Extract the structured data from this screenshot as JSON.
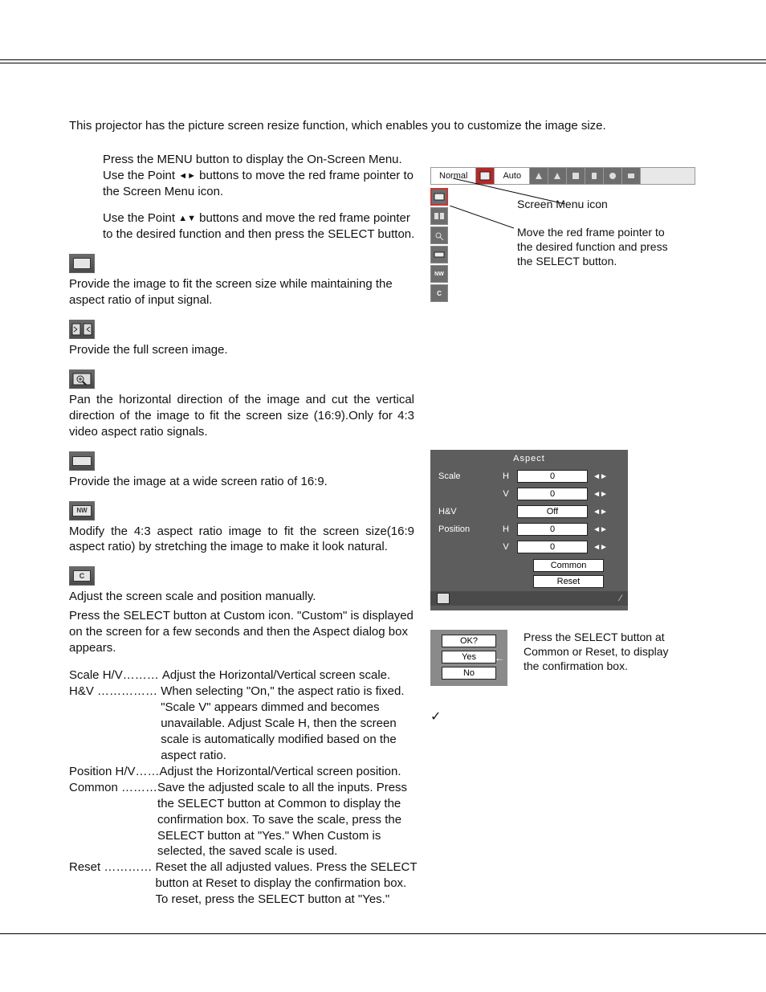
{
  "intro": "This projector has the picture screen resize function, which enables you to customize the image size.",
  "steps": {
    "s1a": "Press the MENU button to display the On-Screen Menu. Use the Point ",
    "s1b": " buttons to move the red frame pointer to the Screen Menu icon.",
    "s2a": "Use the Point ",
    "s2b": " buttons and move the red frame pointer to the desired function and then press the SELECT button."
  },
  "sections": {
    "normal": "Provide the image to fit the screen size while maintaining the aspect ratio of input signal.",
    "full": "Provide the full screen image.",
    "zoom": "Pan the horizontal direction of the image and cut the vertical direction of the image to fit the screen size (16:9).Only for 4:3 video aspect ratio signals.",
    "wide": "Provide the image at a wide screen ratio of 16:9.",
    "nw": "Modify the 4:3 aspect ratio image to fit the screen size(16:9 aspect ratio) by stretching the image to make it look natural.",
    "custom1": "Adjust the screen scale and position manually.",
    "custom2": "Press the SELECT button at Custom icon. \"Custom\" is displayed on the screen for a few seconds and then the Aspect dialog box appears."
  },
  "defs": {
    "scale": {
      "term": "Scale H/V",
      "dots": "………",
      "body": "Adjust the Horizontal/Vertical screen scale."
    },
    "hv": {
      "term": "H&V",
      "dots": " ……………",
      "body": "When selecting \"On,\" the aspect ratio is fixed. \"Scale V\" appears dimmed and becomes unavailable. Adjust Scale H, then the screen scale is automatically modified based on the aspect ratio."
    },
    "pos": {
      "term": "Position H/V",
      "dots": "……",
      "body": "Adjust the Horizontal/Vertical screen position."
    },
    "common": {
      "term": "Common",
      "dots": " ………",
      "body": "Save the adjusted scale to all the inputs. Press the SELECT button at Common to display the confirmation box. To save the scale, press the SELECT button at \"Yes.\" When Custom is selected, the saved scale is used."
    },
    "reset": {
      "term": "Reset",
      "dots": " …………",
      "body": "Reset the all adjusted values. Press the SELECT button at Reset to display the confirmation box. To reset, press the SELECT button at \"Yes.\""
    }
  },
  "fig1": {
    "normal": "Normal",
    "auto": "Auto",
    "cap1": "Screen Menu icon",
    "cap2": "Move the red frame pointer to the desired function and press the SELECT button.",
    "nw": "NW",
    "c": "C"
  },
  "fig2": {
    "title": "Aspect",
    "scale": "Scale",
    "hv": "H&V",
    "position": "Position",
    "h": "H",
    "v": "V",
    "zero": "0",
    "off": "Off",
    "common": "Common",
    "reset": "Reset"
  },
  "fig3": {
    "ok": "OK?",
    "yes": "Yes",
    "no": "No",
    "cap": "Press the SELECT button at Common or Reset, to display the confirmation box."
  },
  "check": "✓"
}
